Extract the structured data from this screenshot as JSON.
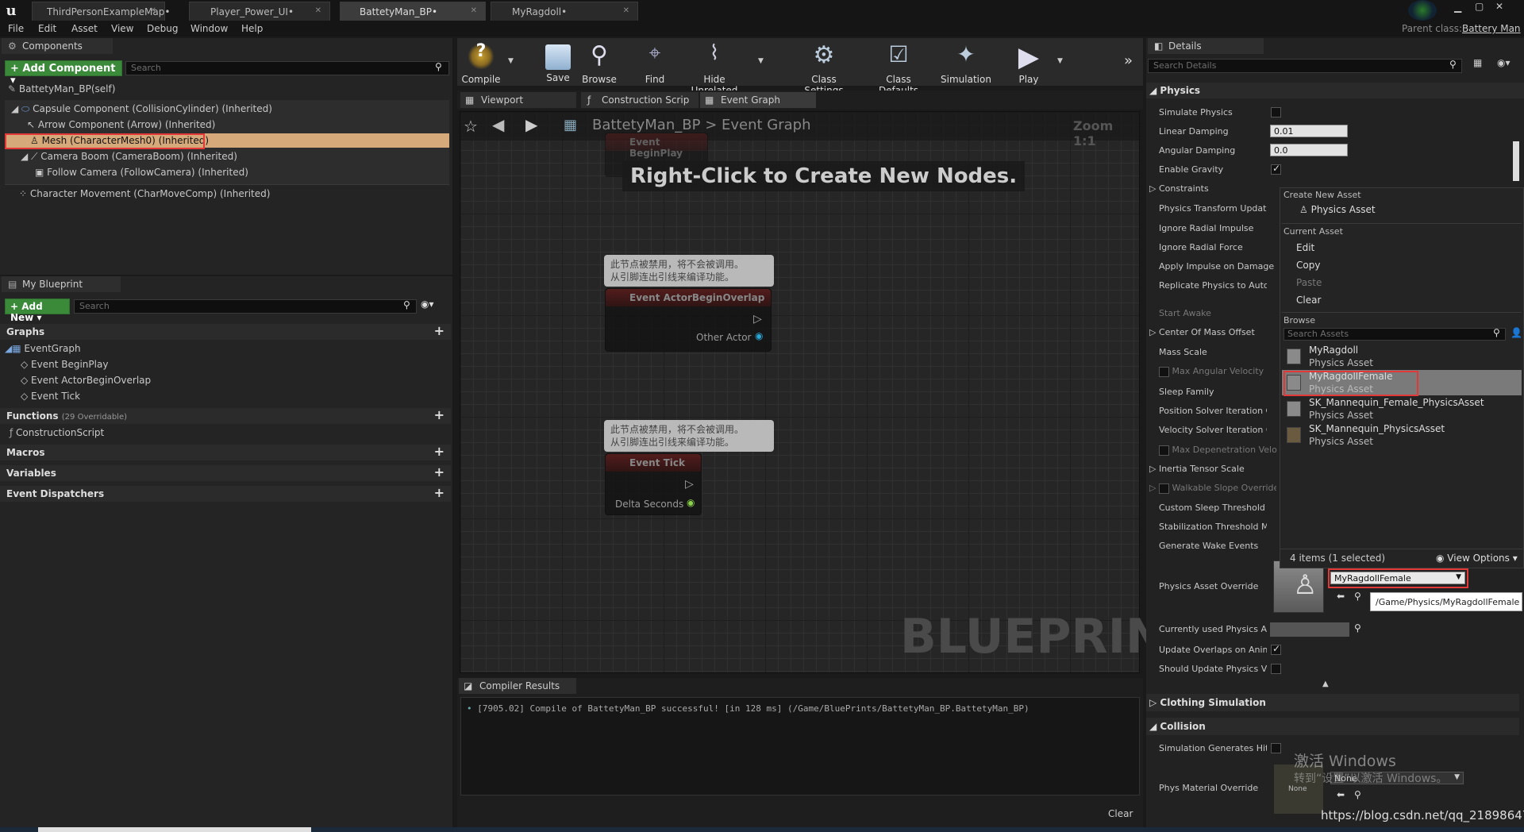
{
  "tabs": [
    "ThirdPersonExampleMap•",
    "Player_Power_UI•",
    "BattetyMan_BP•",
    "MyRagdoll•"
  ],
  "parent_class_label": "Parent class:",
  "parent_class_value": "Battery Man",
  "menu": [
    "File",
    "Edit",
    "Asset",
    "View",
    "Debug",
    "Window",
    "Help"
  ],
  "components": {
    "title": "Components",
    "add_label": "+ Add Component ▾",
    "search_placeholder": "Search",
    "items": [
      "BattetyMan_BP(self)",
      "Capsule Component (CollisionCylinder) (Inherited)",
      "Arrow Component (Arrow) (Inherited)",
      "Mesh (CharacterMesh0) (Inherited)",
      "Camera Boom (CameraBoom) (Inherited)",
      "Follow Camera (FollowCamera) (Inherited)",
      "Character Movement (CharMoveComp) (Inherited)"
    ]
  },
  "my_blueprint": {
    "title": "My Blueprint",
    "add_label": "+ Add New ▾",
    "search_placeholder": "Search",
    "graphs_label": "Graphs",
    "event_graph": "EventGraph",
    "events": [
      "Event BeginPlay",
      "Event ActorBeginOverlap",
      "Event Tick"
    ],
    "functions_label": "Functions",
    "functions_note": "(29 Overridable)",
    "construction": "ConstructionScript",
    "macros": "Macros",
    "variables": "Variables",
    "dispatchers": "Event Dispatchers"
  },
  "toolbar": [
    "Compile",
    "Save",
    "Browse",
    "Find",
    "Hide Unrelated",
    "Class Settings",
    "Class Defaults",
    "Simulation",
    "Play"
  ],
  "editor_tabs": [
    "Viewport",
    "Construction Scrip",
    "Event Graph"
  ],
  "breadcrumb": {
    "root": "BattetyMan_BP",
    "sep": ">",
    "current": "Event Graph"
  },
  "zoom": "Zoom 1:1",
  "graph_hint": "Right-Click to Create New Nodes.",
  "watermark": "BLUEPRINT",
  "nodes": {
    "comment_line1": "此节点被禁用，将不会被调用。",
    "comment_line2": "从引脚连出引线来编译功能。",
    "begin_play": "Event BeginPlay",
    "overlap": "Event ActorBeginOverlap",
    "other_actor": "Other Actor",
    "tick": "Event Tick",
    "delta": "Delta Seconds",
    "clipped_comment": "从引脚连出引线来编译功能。"
  },
  "compiler": {
    "title": "Compiler Results",
    "message": "[7905.02] Compile of BattetyMan_BP successful! [in 128 ms] (/Game/BluePrints/BattetyMan_BP.BattetyMan_BP)",
    "clear": "Clear"
  },
  "details": {
    "title": "Details",
    "search_placeholder": "Search Details",
    "physics_section": "Physics",
    "props": [
      "Simulate Physics",
      "Linear Damping",
      "Angular Damping",
      "Enable Gravity",
      "Constraints",
      "Physics Transform Update",
      "Ignore Radial Impulse",
      "Ignore Radial Force",
      "Apply Impulse on Damage",
      "Replicate Physics to Auton",
      "Start Awake",
      "Center Of Mass Offset",
      "Mass Scale",
      "Max Angular Velocity",
      "Sleep Family",
      "Position Solver Iteration Co",
      "Velocity Solver Iteration Co",
      "Max Depenetration Velo",
      "Inertia Tensor Scale",
      "Walkable Slope Override",
      "Custom Sleep Threshold M",
      "Stabilization Threshold Mu",
      "Generate Wake Events",
      "Physics Asset Override",
      "Currently used Physics As",
      "Update Overlaps on Animat",
      "Should Update Physics Volu"
    ],
    "linear_damping": "0.01",
    "angular_damping": "0.0",
    "asset_override_value": "MyRagdollFemale",
    "asset_path_tooltip": "/Game/Physics/MyRagdollFemale",
    "clothing_section": "Clothing Simulation",
    "collision_section": "Collision",
    "sim_hit": "Simulation Generates Hit E",
    "phys_material": "Phys Material Override",
    "none": "None"
  },
  "dropdown": {
    "create_new": "Create New Asset",
    "physics_asset": "Physics Asset",
    "current_asset": "Current Asset",
    "edit": "Edit",
    "copy": "Copy",
    "paste": "Paste",
    "clear": "Clear",
    "browse": "Browse",
    "search_placeholder": "Search Assets",
    "assets": [
      {
        "name": "MyRagdoll",
        "type": "Physics Asset"
      },
      {
        "name": "MyRagdollFemale",
        "type": "Physics Asset"
      },
      {
        "name": "SK_Mannequin_Female_PhysicsAsset",
        "type": "Physics Asset"
      },
      {
        "name": "SK_Mannequin_PhysicsAsset",
        "type": "Physics Asset"
      }
    ],
    "count": "4 items (1 selected)",
    "view_options": "View Options ▾"
  },
  "overlay": {
    "windows1": "激活 Windows",
    "windows2": "转到“设置”以激活 Windows。",
    "url": "https://blog.csdn.net/qq_21898647"
  }
}
